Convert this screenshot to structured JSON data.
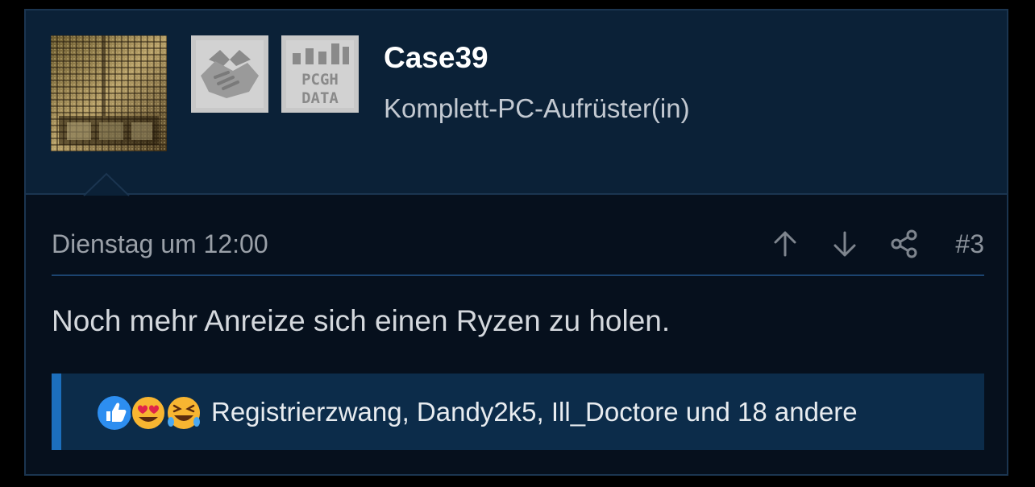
{
  "user": {
    "name": "Case39",
    "title": "Komplett-PC-Aufrüster(in)",
    "badges": [
      {
        "icon": "handshake-icon"
      },
      {
        "icon": "pcgh-data-icon",
        "text_line1": "PCGH",
        "text_line2": "DATA"
      }
    ]
  },
  "post": {
    "date": "Dienstag um 12:00",
    "number": "#3",
    "actions": [
      "arrow-up-icon",
      "arrow-down-icon",
      "share-icon"
    ],
    "message": "Noch mehr Anreize sich einen Ryzen zu holen."
  },
  "reactions": {
    "icons": [
      "like-icon",
      "love-icon",
      "haha-icon"
    ],
    "text": "Registrierzwang, Dandy2k5, Ill_Doctore und 18 andere"
  },
  "colors": {
    "header_bg": "#0b2137",
    "post_bg": "#06101d",
    "accent": "#1c6fbd",
    "reaction_bg": "#0c2c4a"
  }
}
